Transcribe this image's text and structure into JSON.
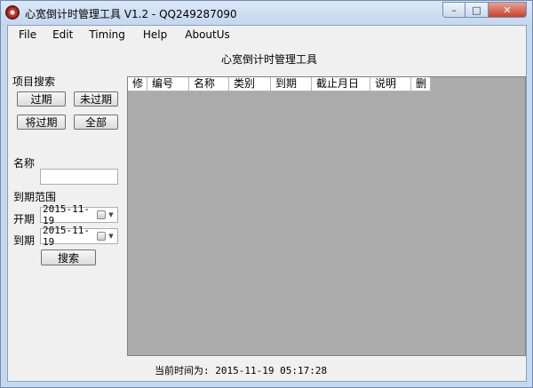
{
  "window": {
    "title": "心宽倒计时管理工具 V1.2 - QQ249287090",
    "controls": [
      "minimize",
      "maximize",
      "close"
    ]
  },
  "menu": [
    "File",
    "Edit",
    "Timing",
    "Help",
    "AboutUs"
  ],
  "header_title": "心宽倒计时管理工具",
  "search_panel": {
    "section_label": "项目搜索",
    "buttons": {
      "expired": "过期",
      "not_expired": "未过期",
      "expiring": "将过期",
      "all": "全部"
    },
    "name_label": "名称",
    "name_value": "",
    "range_label": "到期范围",
    "start_label": "开期",
    "start_date": "2015-11-19",
    "end_label": "到期",
    "end_date": "2015-11-19",
    "search_button": "搜索"
  },
  "table": {
    "columns": [
      "修",
      "编号",
      "名称",
      "类别",
      "到期",
      "截止月日",
      "说明",
      "删"
    ]
  },
  "status": {
    "current_time": "当前时间为: 2015-11-19 05:17:28"
  }
}
